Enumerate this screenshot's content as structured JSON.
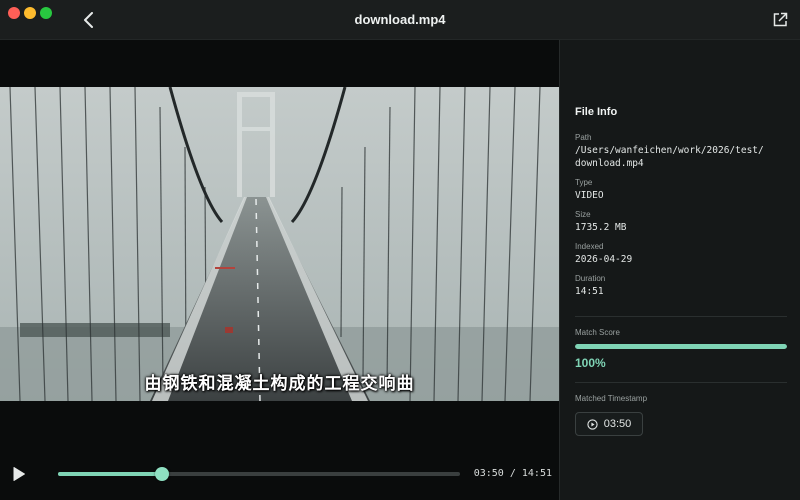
{
  "window": {
    "title": "download.mp4"
  },
  "player": {
    "subtitle": "由钢铁和混凝土构成的工程交响曲",
    "current_time": "03:50",
    "duration": "14:51",
    "time_display": "03:50 / 14:51",
    "progress_fraction": 0.258
  },
  "file_info": {
    "heading": "File Info",
    "path_label": "Path",
    "path_line1": "/Users/wanfeichen/work/2026/test/",
    "path_line2": "download.mp4",
    "type_label": "Type",
    "type_value": "VIDEO",
    "size_label": "Size",
    "size_value": "1735.2 MB",
    "indexed_label": "Indexed",
    "indexed_value": "2026-04-29",
    "duration_label": "Duration",
    "duration_value": "14:51"
  },
  "match": {
    "score_label": "Match Score",
    "score_value": "100%",
    "score_fraction": 1.0,
    "timestamp_label": "Matched Timestamp",
    "timestamp_value": "03:50"
  },
  "colors": {
    "accent": "#7fd4b5",
    "background": "#0f1212",
    "panel": "#151818"
  },
  "icons": {
    "back": "chevron-left-icon",
    "external": "open-external-icon",
    "play": "play-icon",
    "timestamp": "play-circle-icon"
  }
}
